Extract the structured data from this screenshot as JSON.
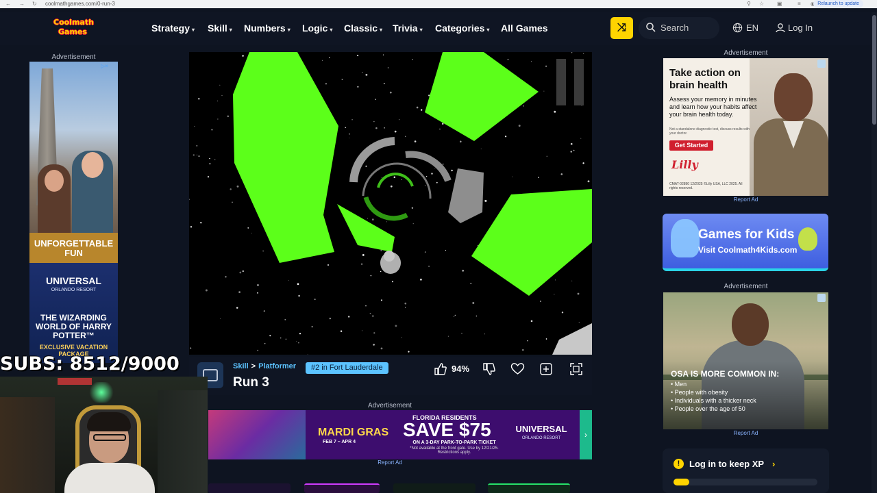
{
  "browser": {
    "url": "coolmathgames.com/0-run-3",
    "relaunch": "Relaunch to update"
  },
  "header": {
    "logo_line1": "Coolmath",
    "logo_line2": "Games",
    "nav": [
      {
        "label": "Strategy",
        "dropdown": true
      },
      {
        "label": "Skill",
        "dropdown": true
      },
      {
        "label": "Numbers",
        "dropdown": true
      },
      {
        "label": "Logic",
        "dropdown": true
      },
      {
        "label": "Classic",
        "dropdown": true
      },
      {
        "label": "Trivia",
        "dropdown": true
      },
      {
        "label": "Categories",
        "dropdown": true
      },
      {
        "label": "All Games",
        "dropdown": false
      }
    ],
    "search_placeholder": "Search",
    "language": "EN",
    "login": "Log In",
    "accent_color": "#ffd400"
  },
  "ads": {
    "label": "Advertisement",
    "report": "Report Ad",
    "left": {
      "headline": "UNFORGETTABLE FUN",
      "brand": "UNIVERSAL",
      "brand_sub": "ORLANDO RESORT",
      "title": "THE WIZARDING WORLD OF HARRY POTTER™",
      "package": "EXCLUSIVE VACATION PACKAGE"
    },
    "center": {
      "event": "MARDI GRAS",
      "event_dates": "FEB 7 – APR 4",
      "residents": "FLORIDA RESIDENTS",
      "offer": "SAVE $75",
      "offer_detail": "ON A 3-DAY PARK-TO-PARK TICKET",
      "offer_fine": "*Not available at the front gate. Use by 12/21/25. Restrictions apply.",
      "brand": "UNIVERSAL",
      "brand_sub": "ORLANDO RESORT"
    },
    "right1": {
      "headline": "Take action on brain health",
      "body": "Assess your memory in minutes and learn how your habits affect your brain health today.",
      "fine": "Not a standalone diagnostic test, discuss results with your doctor.",
      "button": "Get Started",
      "brand": "Lilly",
      "legal": "CMAT-02890 12/2025 ©Lilly USA, LLC 2025. All rights reserved."
    },
    "kids": {
      "title": "Games for Kids",
      "subtitle": "Visit Coolmath4Kids.com"
    },
    "right2": {
      "headline": "OSA IS MORE COMMON IN:",
      "items": [
        "Men",
        "People with obesity",
        "Individuals with a thicker neck",
        "People over the age of 50"
      ]
    }
  },
  "game": {
    "category": "Skill",
    "subcategory": "Platformer",
    "rank_badge": "#2 in Fort Lauderdale",
    "title": "Run 3",
    "rating": "94%",
    "tile_color": "#5cff1a"
  },
  "xp": {
    "text": "Log in to keep XP",
    "progress": 0.11
  },
  "overlay": {
    "subs": "SUBS: 8512/9000"
  }
}
